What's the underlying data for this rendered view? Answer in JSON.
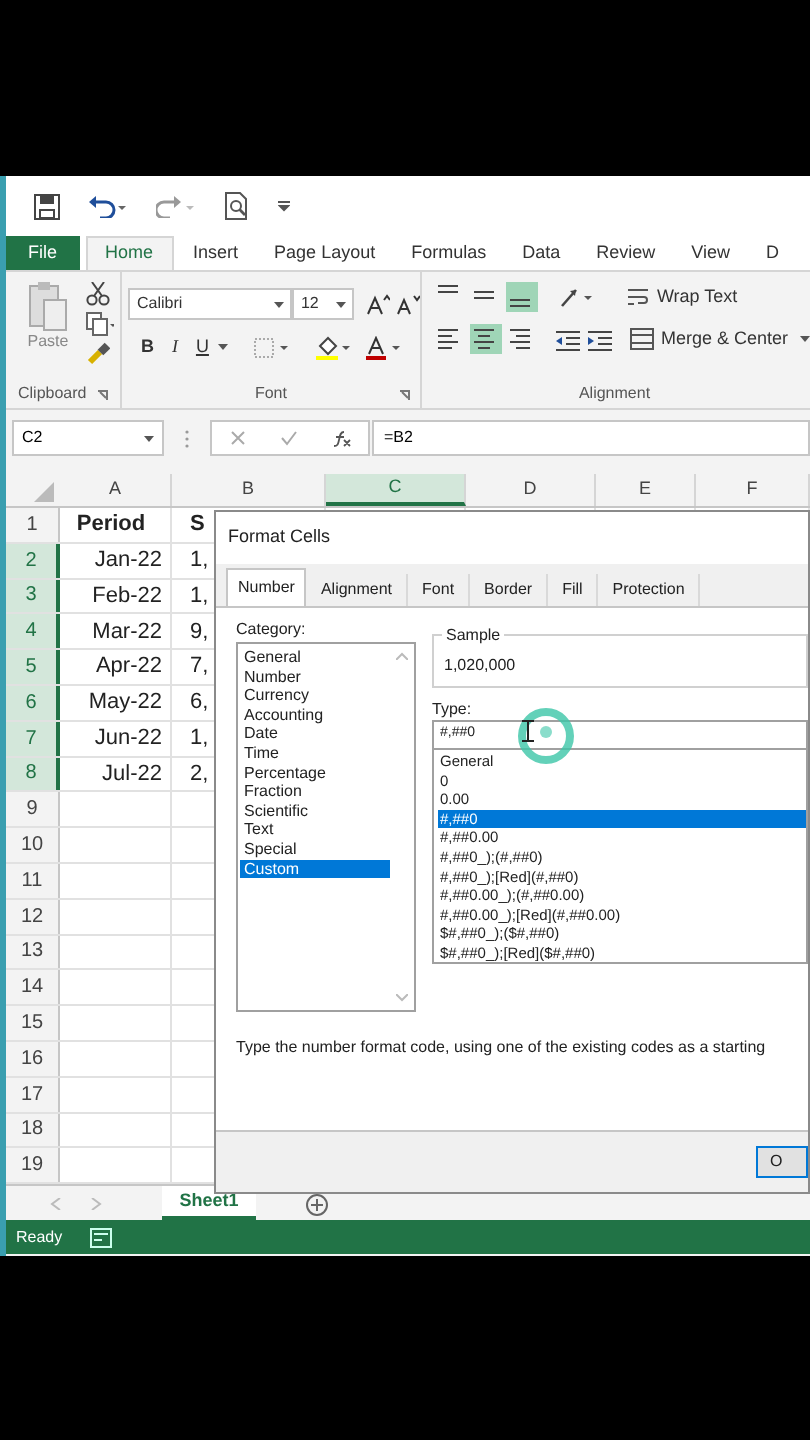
{
  "ribbon_tabs": [
    {
      "label": "File",
      "kind": "file",
      "selected": false
    },
    {
      "label": "Home",
      "kind": "tab",
      "selected": true
    },
    {
      "label": "Insert",
      "kind": "tab",
      "selected": false
    },
    {
      "label": "Page Layout",
      "kind": "tab",
      "selected": false
    },
    {
      "label": "Formulas",
      "kind": "tab",
      "selected": false
    },
    {
      "label": "Data",
      "kind": "tab",
      "selected": false
    },
    {
      "label": "Review",
      "kind": "tab",
      "selected": false
    },
    {
      "label": "View",
      "kind": "tab",
      "selected": false
    },
    {
      "label": "D",
      "kind": "tab",
      "selected": false
    }
  ],
  "ribbon": {
    "clipboard": {
      "paste_label": "Paste",
      "group_label": "Clipboard"
    },
    "font": {
      "font_name": "Calibri",
      "font_size": "12",
      "bold": "B",
      "italic": "I",
      "underline": "U",
      "group_label": "Font"
    },
    "alignment": {
      "vertical_align_buttons": [
        {
          "selected": false
        },
        {
          "selected": false
        },
        {
          "selected": true
        }
      ],
      "horizontal_align_buttons": [
        {
          "selected": false
        },
        {
          "selected": true
        },
        {
          "selected": false
        }
      ],
      "wrap_text": "Wrap Text",
      "merge_center": "Merge & Center",
      "group_label": "Alignment"
    }
  },
  "formula_bar": {
    "name_box": "C2",
    "formula": "=B2"
  },
  "sheet": {
    "columns": [
      {
        "label": "A",
        "selected": false
      },
      {
        "label": "B",
        "selected": false
      },
      {
        "label": "C",
        "selected": true
      },
      {
        "label": "D",
        "selected": false
      },
      {
        "label": "E",
        "selected": false
      },
      {
        "label": "F",
        "selected": false
      }
    ],
    "rows": [
      {
        "number": "1",
        "selected": false,
        "cells": [
          {
            "text": "Period",
            "bold": true
          },
          {
            "text": "S",
            "bold": true
          }
        ]
      },
      {
        "number": "2",
        "selected": true,
        "cells": [
          {
            "text": "Jan-22",
            "bold": false
          },
          {
            "text": "1,",
            "bold": false
          }
        ]
      },
      {
        "number": "3",
        "selected": true,
        "cells": [
          {
            "text": "Feb-22",
            "bold": false
          },
          {
            "text": "1,",
            "bold": false
          }
        ]
      },
      {
        "number": "4",
        "selected": true,
        "cells": [
          {
            "text": "Mar-22",
            "bold": false
          },
          {
            "text": "9,",
            "bold": false
          }
        ]
      },
      {
        "number": "5",
        "selected": true,
        "cells": [
          {
            "text": "Apr-22",
            "bold": false
          },
          {
            "text": "7,",
            "bold": false
          }
        ]
      },
      {
        "number": "6",
        "selected": true,
        "cells": [
          {
            "text": "May-22",
            "bold": false
          },
          {
            "text": "6,",
            "bold": false
          }
        ]
      },
      {
        "number": "7",
        "selected": true,
        "cells": [
          {
            "text": "Jun-22",
            "bold": false
          },
          {
            "text": "1,",
            "bold": false
          }
        ]
      },
      {
        "number": "8",
        "selected": true,
        "cells": [
          {
            "text": "Jul-22",
            "bold": false
          },
          {
            "text": "2,",
            "bold": false
          }
        ]
      },
      {
        "number": "9",
        "selected": false,
        "cells": []
      },
      {
        "number": "10",
        "selected": false,
        "cells": []
      },
      {
        "number": "11",
        "selected": false,
        "cells": []
      },
      {
        "number": "12",
        "selected": false,
        "cells": []
      },
      {
        "number": "13",
        "selected": false,
        "cells": []
      },
      {
        "number": "14",
        "selected": false,
        "cells": []
      },
      {
        "number": "15",
        "selected": false,
        "cells": []
      },
      {
        "number": "16",
        "selected": false,
        "cells": []
      },
      {
        "number": "17",
        "selected": false,
        "cells": []
      },
      {
        "number": "18",
        "selected": false,
        "cells": []
      },
      {
        "number": "19",
        "selected": false,
        "cells": []
      }
    ]
  },
  "dialog": {
    "title": "Format Cells",
    "tabs": [
      {
        "label": "Number",
        "selected": true
      },
      {
        "label": "Alignment",
        "selected": false
      },
      {
        "label": "Font",
        "selected": false
      },
      {
        "label": "Border",
        "selected": false
      },
      {
        "label": "Fill",
        "selected": false
      },
      {
        "label": "Protection",
        "selected": false
      }
    ],
    "category_label": "Category:",
    "categories": [
      {
        "label": "General",
        "selected": false
      },
      {
        "label": "Number",
        "selected": false
      },
      {
        "label": "Currency",
        "selected": false
      },
      {
        "label": "Accounting",
        "selected": false
      },
      {
        "label": "Date",
        "selected": false
      },
      {
        "label": "Time",
        "selected": false
      },
      {
        "label": "Percentage",
        "selected": false
      },
      {
        "label": "Fraction",
        "selected": false
      },
      {
        "label": "Scientific",
        "selected": false
      },
      {
        "label": "Text",
        "selected": false
      },
      {
        "label": "Special",
        "selected": false
      },
      {
        "label": "Custom",
        "selected": true
      }
    ],
    "sample_label": "Sample",
    "sample_value": "1,020,000",
    "type_label": "Type:",
    "type_value": "#,##0",
    "formats": [
      {
        "label": "General",
        "selected": false
      },
      {
        "label": "0",
        "selected": false
      },
      {
        "label": "0.00",
        "selected": false
      },
      {
        "label": "#,##0",
        "selected": true
      },
      {
        "label": "#,##0.00",
        "selected": false
      },
      {
        "label": "#,##0_);(#,##0)",
        "selected": false
      },
      {
        "label": "#,##0_);[Red](#,##0)",
        "selected": false
      },
      {
        "label": "#,##0.00_);(#,##0.00)",
        "selected": false
      },
      {
        "label": "#,##0.00_);[Red](#,##0.00)",
        "selected": false
      },
      {
        "label": "$#,##0_);($#,##0)",
        "selected": false
      },
      {
        "label": "$#,##0_);[Red]($#,##0)",
        "selected": false
      }
    ],
    "description": "Type the number format code, using one of the existing codes as a starting",
    "ok_button": "O"
  },
  "sheet_tabs": [
    {
      "label": "Sheet1",
      "selected": true
    }
  ],
  "status_bar": {
    "text": "Ready"
  }
}
